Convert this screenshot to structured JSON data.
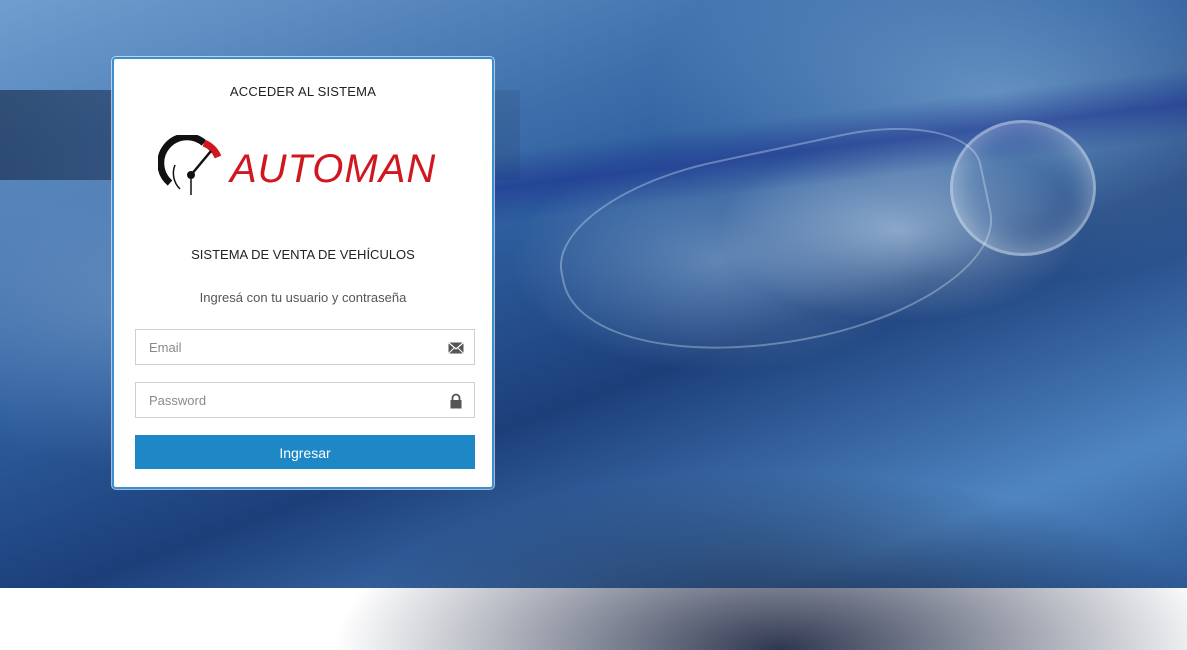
{
  "login": {
    "header": "ACCEDER AL SISTEMA",
    "logo_text": "AUTOMAN",
    "subtitle": "SISTEMA DE VENTA DE VEHÍCULOS",
    "instructions": "Ingresá con tu usuario y contraseña",
    "email": {
      "placeholder": "Email",
      "value": "",
      "icon": "envelope-icon"
    },
    "password": {
      "placeholder": "Password",
      "value": "",
      "icon": "lock-icon"
    },
    "submit_label": "Ingresar"
  },
  "colors": {
    "brand_red": "#d0161f",
    "button_blue": "#1e88c7",
    "card_border": "#3a8fd0"
  }
}
